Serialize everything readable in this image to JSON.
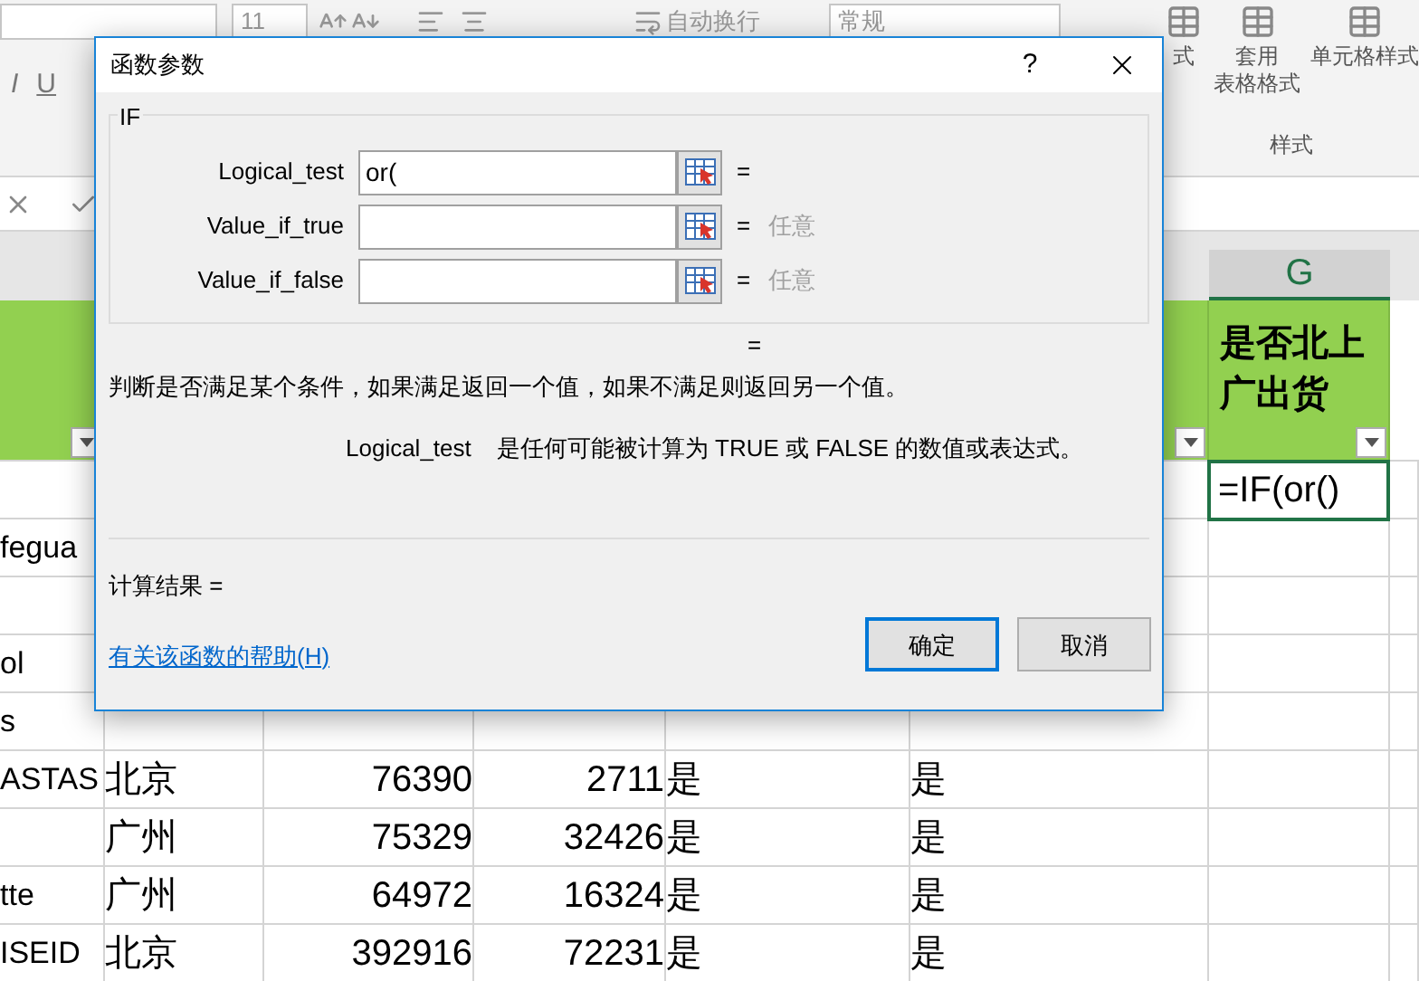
{
  "ribbon": {
    "font_size": "11",
    "wrap_text": "自动换行",
    "number_format": "常规",
    "format_buttons": [
      "I",
      "U"
    ],
    "style_buttons": [
      {
        "lines": [
          "式"
        ]
      },
      {
        "lines": [
          "套用",
          "表格格式"
        ]
      },
      {
        "lines": [
          "单元格样式"
        ]
      }
    ],
    "group_label": "样式"
  },
  "sheet": {
    "column_header": "G",
    "header_label": "是否北上广出货",
    "rows": [
      {
        "cells": {
          "G": {
            "text": "=IF(or()",
            "selected": true
          }
        }
      },
      {
        "cells": {
          "A": {
            "text": "fegua",
            "selected": false
          }
        }
      },
      {
        "cells": {}
      },
      {
        "cells": {
          "A": {
            "text": "ol",
            "selected": false
          }
        }
      },
      {
        "cells": {
          "A": {
            "text": "s",
            "selected": false
          }
        }
      },
      {
        "cells": {
          "A": {
            "text": "ASTAS",
            "selected": false
          },
          "B": {
            "text": "北京",
            "selected": false
          },
          "C": {
            "text": "76390",
            "selected": false
          },
          "D": {
            "text": "2711",
            "selected": false
          },
          "E": {
            "text": "是",
            "selected": false
          },
          "F": {
            "text": "是",
            "selected": false
          }
        }
      },
      {
        "cells": {
          "B": {
            "text": "广州",
            "selected": false
          },
          "C": {
            "text": "75329",
            "selected": false
          },
          "D": {
            "text": "32426",
            "selected": false
          },
          "E": {
            "text": "是",
            "selected": false
          },
          "F": {
            "text": "是",
            "selected": false
          }
        }
      },
      {
        "cells": {
          "A": {
            "text": "tte",
            "selected": false
          },
          "B": {
            "text": "广州",
            "selected": false
          },
          "C": {
            "text": "64972",
            "selected": false
          },
          "D": {
            "text": "16324",
            "selected": false
          },
          "E": {
            "text": "是",
            "selected": false
          },
          "F": {
            "text": "是",
            "selected": false
          }
        }
      },
      {
        "cells": {
          "A": {
            "text": "ISEID",
            "selected": false
          },
          "B": {
            "text": "北京",
            "selected": false
          },
          "C": {
            "text": "392916",
            "selected": false
          },
          "D": {
            "text": "72231",
            "selected": false
          },
          "E": {
            "text": "是",
            "selected": false
          },
          "F": {
            "text": "是",
            "selected": false
          }
        }
      }
    ]
  },
  "dialog": {
    "title": "函数参数",
    "help": "?",
    "function_name": "IF",
    "arguments": [
      {
        "label": "Logical_test",
        "value": "or(",
        "result": "="
      },
      {
        "label": "Value_if_true",
        "result": "=",
        "hint": "任意"
      },
      {
        "label": "Value_if_false",
        "result": "=",
        "hint": "任意"
      }
    ],
    "formula_result": "=",
    "description": "判断是否满足某个条件，如果满足返回一个值，如果不满足则返回另一个值。",
    "argument_help": {
      "name": "Logical_test",
      "text": "是任何可能被计算为 TRUE 或 FALSE 的数值或表达式。"
    },
    "calc_result": "计算结果 =",
    "help_link": "有关该函数的帮助(H)",
    "buttons": [
      {
        "label": "确定",
        "default": true
      },
      {
        "label": "取消",
        "default": false
      }
    ]
  }
}
